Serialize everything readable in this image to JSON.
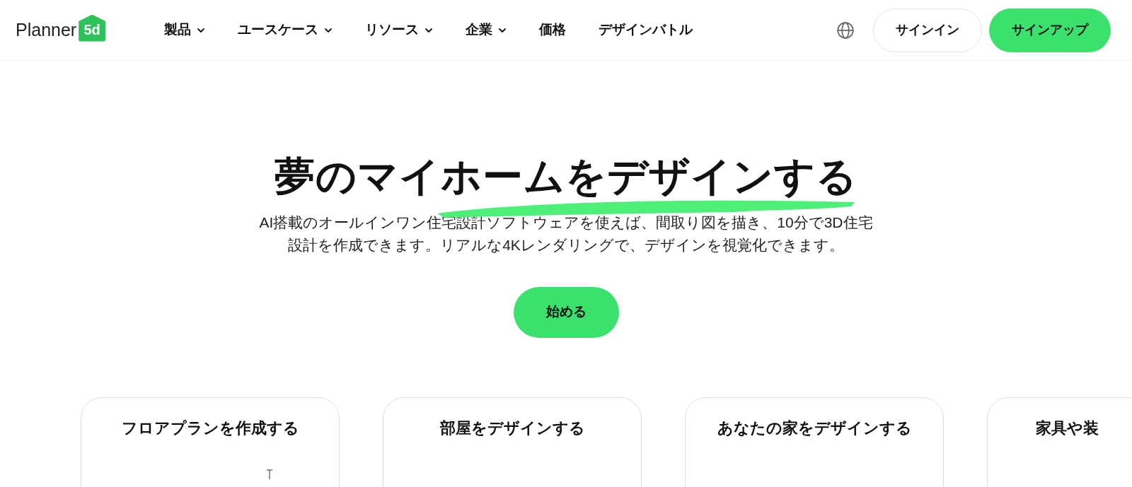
{
  "header": {
    "logo": {
      "wordmark": "Planner",
      "badge": "5d"
    },
    "nav": [
      {
        "label": "製品",
        "dropdown": true
      },
      {
        "label": "ユースケース",
        "dropdown": true
      },
      {
        "label": "リソース",
        "dropdown": true
      },
      {
        "label": "企業",
        "dropdown": true
      },
      {
        "label": "価格",
        "dropdown": false
      },
      {
        "label": "デザインバトル",
        "dropdown": false
      }
    ],
    "sign_in": "サインイン",
    "sign_up": "サインアップ"
  },
  "hero": {
    "title": "夢のマイホームをデザインする",
    "subtitle_lines": [
      "AI搭載のオールインワン住宅設計ソフトウェアを使えば、間取り図を描き、10分で3D住宅",
      "設計を作成できます。リアルな4Kレンダリングで、デザインを視覚化できます。"
    ],
    "cta": "始める"
  },
  "cards": [
    {
      "title": "フロアプランを作成する",
      "kind": "full"
    },
    {
      "title": "部屋をデザインする",
      "kind": "full"
    },
    {
      "title": "あなたの家をデザインする",
      "kind": "full"
    },
    {
      "title": "家具や装",
      "kind": "partial"
    }
  ]
}
